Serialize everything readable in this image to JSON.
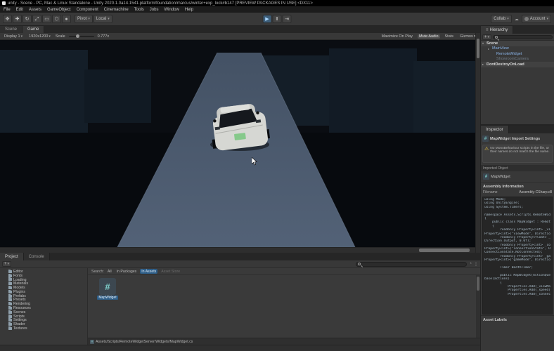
{
  "window": {
    "title": "unity - Scene - PC, Mac & Linux Standalone - Unity 2020.1.0a14.1541.platform/foundation/marcus/winter+exp_lock#b147 [PREVIEW PACKAGES IN USE] <DX11>"
  },
  "menu": {
    "items": [
      "File",
      "Edit",
      "Assets",
      "GameObject",
      "Component",
      "Cinemachine",
      "Tools",
      "Jobs",
      "Window",
      "Help"
    ]
  },
  "toolbar": {
    "tools": [
      {
        "name": "hand-tool",
        "glyph": "✥"
      },
      {
        "name": "move-tool",
        "glyph": "✚"
      },
      {
        "name": "rotate-tool",
        "glyph": "↻"
      },
      {
        "name": "scale-tool",
        "glyph": "⤢"
      },
      {
        "name": "rect-tool",
        "glyph": "▭"
      },
      {
        "name": "transform-tool",
        "glyph": "⬡"
      },
      {
        "name": "custom-tool",
        "glyph": "●"
      }
    ],
    "pivot": "Pivot",
    "local": "Local",
    "play_glyph": "▶",
    "pause_glyph": "Ⅱ",
    "step_glyph": "⇥",
    "collab": "Collab",
    "cloud_glyph": "☁",
    "account": "Account",
    "caret": "▾"
  },
  "scene_tabs": [
    {
      "label": "Scene",
      "cls": ""
    },
    {
      "label": "Game",
      "cls": "active"
    }
  ],
  "game_toolbar": {
    "display": "Display 1",
    "resolution": "1920x1200",
    "scale_label": "Scale",
    "scale_value": "0.777x",
    "items_right": [
      {
        "label": "Maximize On Play",
        "cls": ""
      },
      {
        "label": "Mute Audio",
        "cls": "active"
      },
      {
        "label": "Stats",
        "cls": ""
      },
      {
        "label": "Gizmos ▾",
        "cls": ""
      }
    ]
  },
  "scene": {
    "background_color": "#0a0d12",
    "road_color": "#4c5b6f",
    "car_body_color": "#d6d7d3",
    "plate_color": "#86c98b"
  },
  "hierarchy": {
    "tab": "Hierarchy",
    "items": [
      {
        "label": "Scene",
        "arrow": "▾",
        "cls": "row-scene"
      },
      {
        "label": "MainView",
        "arrow": "▸",
        "cls": "prefab"
      },
      {
        "label": "RemoteWidget",
        "arrow": "",
        "cls": "prefab indent2"
      },
      {
        "label": "ShowroomCamera",
        "arrow": "",
        "cls": "dim indent2"
      },
      {
        "label": "DontDestroyOnLoad",
        "arrow": "▸",
        "cls": "row-scene"
      }
    ]
  },
  "inspector": {
    "tab": "Inspector",
    "header": "MapWidget Import Settings",
    "warning": "No MonoBehaviour scripts in the file, or their names do not match the file name.",
    "imported_object_label": "Imported Object",
    "object_name": "MapWidget",
    "assembly_section": "Assembly Information",
    "filename_label": "Filename",
    "filename_value": "Assembly-CSharp.dll",
    "asset_labels": "Asset Labels",
    "code_lines": [
      "using Mode;",
      "using UnityEngine;",
      "using System.Timers;",
      "",
      "namespace Assets.Scripts.RemoteWidgets",
      "{",
      "    public class MapWidget : RemoteWidget",
      "    {",
      "        readonly Property<int> _viewMode = new",
      "Property<int>(\"viewMode\", Direction.Input);",
      "        readonly Property<float> _speed = new",
      "Direction.Output, 0.0f);",
      "        readonly Property<int> _connectionState = new",
      "Property<int>(\"connectionState\", Direction.Output,",
      "ConnectionState.NotConnected);",
      "        readonly Property<int> _gameMode = new",
      "Property<int>(\"gameMode\", Direction.Output);",
      "",
      "        Timer BoothTimer;",
      "",
      "        public MapWidget(ActionQueue actions) :",
      "base(actions)",
      "        {",
      "            Properties.Add(_viewMode);",
      "            Properties.Add(_speed);",
      "            Properties.Add(_connectionState);"
    ]
  },
  "project": {
    "tab_project": "Project",
    "tab_console": "Console",
    "folders": [
      "Editor",
      "Fonts",
      "Loading",
      "Materials",
      "Models",
      "Plugins",
      "Prefabs",
      "Presets",
      "Rendering",
      "Resources",
      "Scenes",
      "Scripts",
      "Settings",
      "Shader",
      "Textures"
    ],
    "search_label": "Search:",
    "scopes": [
      {
        "label": "All",
        "cls": ""
      },
      {
        "label": "In Packages",
        "cls": ""
      },
      {
        "label": "In Assets",
        "cls": "active"
      },
      {
        "label": "Asset Store",
        "cls": "dim"
      }
    ],
    "asset_name": "MapWidget",
    "asset_glyph": "#",
    "path": "Assets/Scripts/RemoteWidgetServer/Widgets/MapWidget.cs"
  }
}
